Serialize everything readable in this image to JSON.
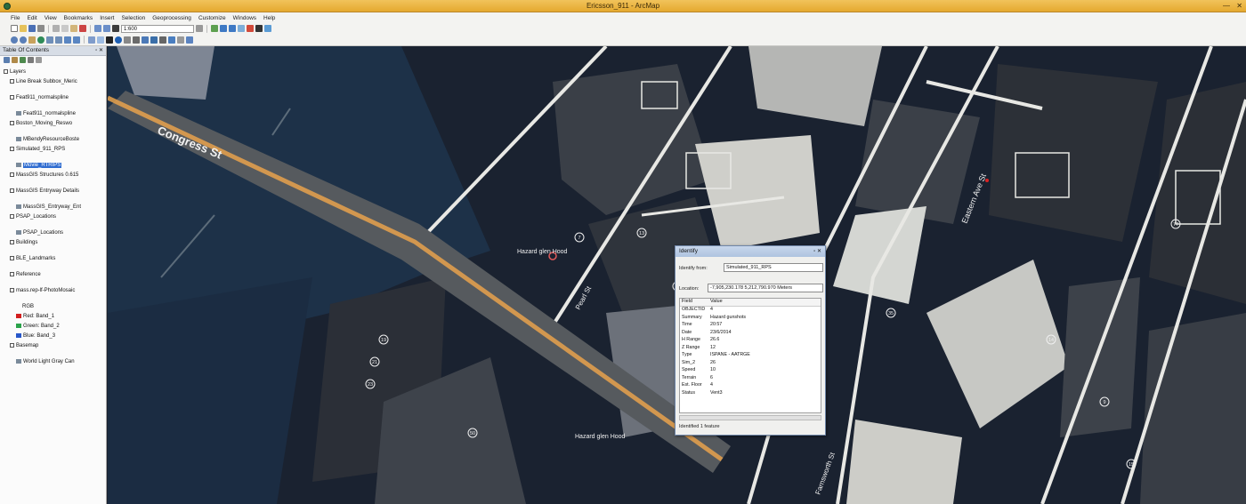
{
  "window": {
    "title": "Ericsson_911 - ArcMap",
    "controls": [
      "—",
      "✕"
    ]
  },
  "menu": [
    "File",
    "Edit",
    "View",
    "Bookmarks",
    "Insert",
    "Selection",
    "Geoprocessing",
    "Customize",
    "Windows",
    "Help"
  ],
  "toolbar": {
    "scale_value": "1:600"
  },
  "toc": {
    "title": "Table Of Contents",
    "pin": "▫ ✕",
    "items": [
      {
        "label": "Layers",
        "indent": 0,
        "type": "group"
      },
      {
        "label": "Line Break Subbox_Meric",
        "indent": 1,
        "type": "layer"
      },
      {
        "label": "Feat911_normalspline",
        "indent": 1,
        "type": "layer"
      },
      {
        "label": "Feat911_normalspline",
        "indent": 2,
        "type": "sub"
      },
      {
        "label": "Boston_Moving_Reswo",
        "indent": 1,
        "type": "layer"
      },
      {
        "label": "MBendyResourceBoste",
        "indent": 2,
        "type": "sub"
      },
      {
        "label": "Simulated_911_RPS",
        "indent": 1,
        "type": "layer"
      },
      {
        "label": "Movie_RTRIPS",
        "indent": 2,
        "type": "selected"
      },
      {
        "label": "MassGIS Structures 0.615",
        "indent": 1,
        "type": "layer"
      },
      {
        "label": "MassGIS Entryway Details",
        "indent": 1,
        "type": "layer"
      },
      {
        "label": "MassGIS_Entryway_Ent",
        "indent": 2,
        "type": "sub"
      },
      {
        "label": "PSAP_Locations",
        "indent": 1,
        "type": "layer"
      },
      {
        "label": "PSAP_Locations",
        "indent": 2,
        "type": "sub"
      },
      {
        "label": "Buildings",
        "indent": 1,
        "type": "layer"
      },
      {
        "label": "BLE_Landmarks",
        "indent": 1,
        "type": "layer"
      },
      {
        "label": "Reference",
        "indent": 1,
        "type": "layer"
      },
      {
        "label": "mass.rep-lf-PhotoMosaic",
        "indent": 1,
        "type": "layer"
      },
      {
        "label": "RGB",
        "indent": 3,
        "type": "text"
      },
      {
        "label": "Red: Band_1",
        "indent": 2,
        "type": "legend-red"
      },
      {
        "label": "Green: Band_2",
        "indent": 2,
        "type": "legend-green"
      },
      {
        "label": "Blue: Band_3",
        "indent": 2,
        "type": "legend-blue"
      },
      {
        "label": "Basemap",
        "indent": 1,
        "type": "layer"
      },
      {
        "label": "World Light Gray Can",
        "indent": 2,
        "type": "sub"
      }
    ]
  },
  "map": {
    "labels": {
      "congress_st": "Congress St",
      "street_mid": "Eastern Ave St",
      "pearl_st": "Pearl St",
      "farnsworth_st": "Farnsworth St",
      "bottom_label": "Hazard glen Hood",
      "right_st": "Farnsworth St",
      "mid_label": "Hazard glen Hood"
    },
    "building_numbers": [
      "19",
      "21",
      "23",
      "7",
      "13",
      "50",
      "62",
      "14",
      "9",
      "15",
      "35",
      "77"
    ]
  },
  "identify": {
    "title": "Identify",
    "controls": "▫ ✕",
    "identify_from_label": "Identify from:",
    "identify_from_value": "Simulated_911_RPS",
    "location_label": "Location:",
    "location_value": "-7,905,230.178  5,212,790.970 Meters",
    "columns": [
      "Field",
      "Value"
    ],
    "rows": [
      [
        "OBJECTID",
        "4"
      ],
      [
        "Summary",
        "Hazard gunshots"
      ],
      [
        "Time",
        "20:57"
      ],
      [
        "Date",
        "23/6/2014"
      ],
      [
        "H Range",
        "26.6"
      ],
      [
        "Z Range",
        "12"
      ],
      [
        "Type",
        "ISPANE - AATRGE"
      ],
      [
        "Sim_2",
        "26"
      ],
      [
        "Speed",
        "10"
      ],
      [
        "Terrain",
        "6"
      ],
      [
        "Est. Floor",
        "4"
      ],
      [
        "Status",
        "Vent3"
      ]
    ],
    "status_text": "Identified 1 feature"
  },
  "colors": {
    "title_bar": "#e8b23a",
    "selection": "#2f6cd0",
    "road_highlight": "#e8a24c",
    "water": "#1d3148"
  }
}
